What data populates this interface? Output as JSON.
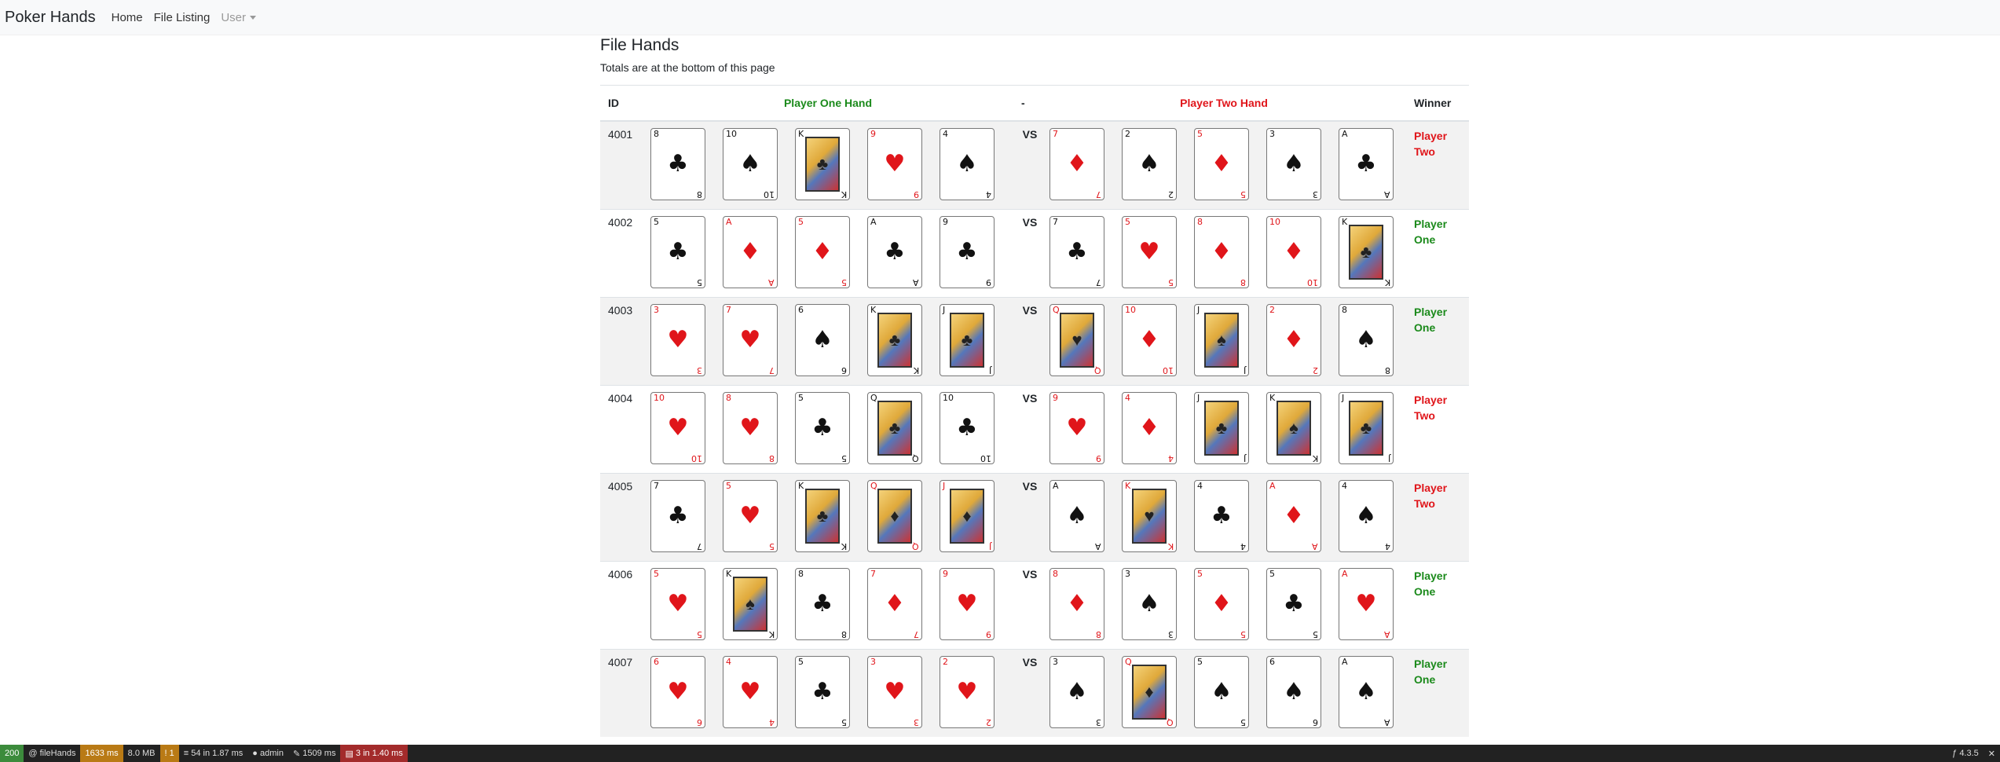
{
  "nav": {
    "brand": "Poker Hands",
    "home": "Home",
    "file_listing": "File Listing",
    "user": "User"
  },
  "page": {
    "title": "File Hands",
    "subtitle": "Totals are at the bottom of this page"
  },
  "table": {
    "headers": {
      "id": "ID",
      "player_one": "Player One Hand",
      "dash": "-",
      "player_two": "Player Two Hand",
      "winner": "Winner"
    },
    "vs": "VS",
    "rows": [
      {
        "id": "4001",
        "p1": [
          "8♣",
          "10♠",
          "K♣",
          "9♥",
          "4♠"
        ],
        "p2": [
          "7♦",
          "2♠",
          "5♦",
          "3♠",
          "A♣"
        ],
        "winner": "Player Two"
      },
      {
        "id": "4002",
        "p1": [
          "5♣",
          "A♦",
          "5♦",
          "A♣",
          "9♣"
        ],
        "p2": [
          "7♣",
          "5♥",
          "8♦",
          "10♦",
          "K♣"
        ],
        "winner": "Player One"
      },
      {
        "id": "4003",
        "p1": [
          "3♥",
          "7♥",
          "6♠",
          "K♣",
          "J♣"
        ],
        "p2": [
          "Q♥",
          "10♦",
          "J♠",
          "2♦",
          "8♠"
        ],
        "winner": "Player One"
      },
      {
        "id": "4004",
        "p1": [
          "10♥",
          "8♥",
          "5♣",
          "Q♣",
          "10♣"
        ],
        "p2": [
          "9♥",
          "4♦",
          "J♣",
          "K♠",
          "J♣"
        ],
        "winner": "Player Two"
      },
      {
        "id": "4005",
        "p1": [
          "7♣",
          "5♥",
          "K♣",
          "Q♦",
          "J♦"
        ],
        "p2": [
          "A♠",
          "K♥",
          "4♣",
          "A♦",
          "4♠"
        ],
        "winner": "Player Two"
      },
      {
        "id": "4006",
        "p1": [
          "5♥",
          "K♠",
          "8♣",
          "7♦",
          "9♥"
        ],
        "p2": [
          "8♦",
          "3♠",
          "5♦",
          "5♣",
          "A♥"
        ],
        "winner": "Player One"
      },
      {
        "id": "4007",
        "p1": [
          "6♥",
          "4♥",
          "5♣",
          "3♥",
          "2♥"
        ],
        "p2": [
          "3♠",
          "Q♦",
          "5♠",
          "6♠",
          "A♠"
        ],
        "winner": "Player One"
      }
    ]
  },
  "debug_bar": {
    "status": "200",
    "route": "@ fileHands",
    "time": "1633 ms",
    "memory": "8.0 MB",
    "warnings": "1",
    "db": "54 in 1.87 ms",
    "user": "admin",
    "twig": "1509 ms",
    "cache": "3 in 1.40 ms",
    "version": "4.3.5"
  }
}
